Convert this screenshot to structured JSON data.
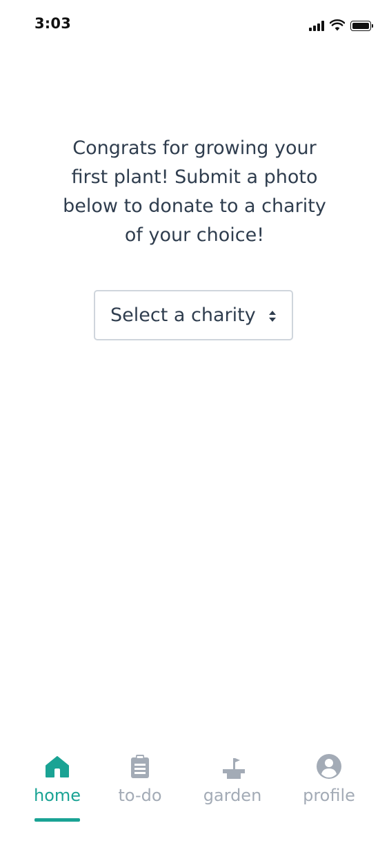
{
  "status_bar": {
    "time": "3:03"
  },
  "main": {
    "message": "Congrats for growing your first plant! Submit a photo below to donate to a charity of your choice!",
    "charity_select": {
      "selected_label": "Select a charity",
      "icon": "updown-arrows-icon"
    }
  },
  "bottom_nav": {
    "active": "home",
    "items": [
      {
        "id": "home",
        "label": "home",
        "icon": "home-icon"
      },
      {
        "id": "todo",
        "label": "to-do",
        "icon": "clipboard-icon"
      },
      {
        "id": "garden",
        "label": "garden",
        "icon": "plant-pot-icon"
      },
      {
        "id": "profile",
        "label": "profile",
        "icon": "user-circle-icon"
      }
    ]
  },
  "colors": {
    "accent": "#1aa394",
    "inactive": "#a3abb6",
    "text": "#2f3d4e",
    "border": "#cfd5dc"
  }
}
